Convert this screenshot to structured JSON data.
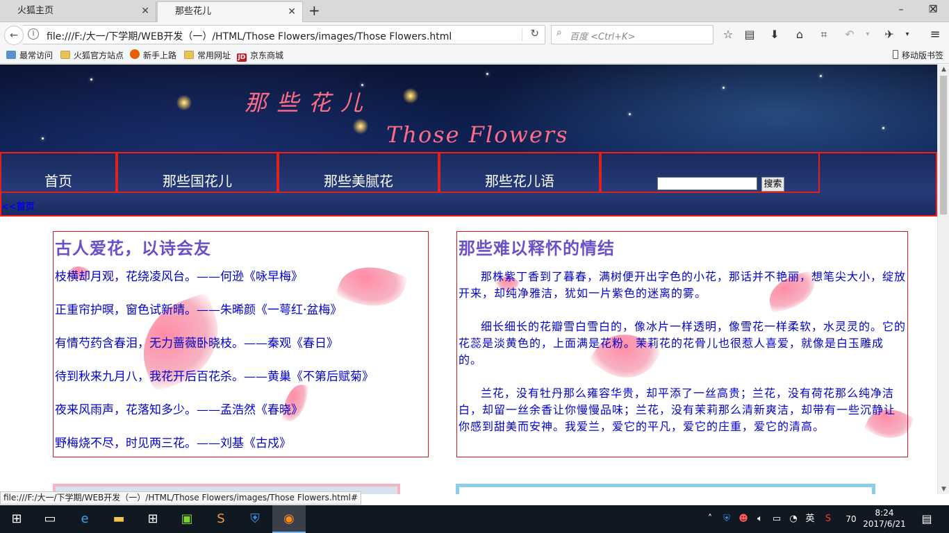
{
  "browser": {
    "tabs": [
      {
        "label": "火狐主页",
        "active": false
      },
      {
        "label": "那些花儿",
        "active": true
      }
    ],
    "new_tab_label": "+",
    "window_controls": {
      "minimize": "–",
      "restore": "❐",
      "close": "✕"
    },
    "url": "file:///F:/大一/下学期/WEB开发（一）/HTML/Those Flowers/images/Those Flowers.html",
    "search_placeholder": "百度 <Ctrl+K>",
    "bookmarks": [
      "最常访问",
      "火狐官方站点",
      "新手上路",
      "常用网址",
      "京东商城"
    ],
    "mobile_bookmarks": "移动版书签",
    "status_url": "file:///F:/大一/下学期/WEB开发（一）/HTML/Those Flowers/images/Those Flowers.html#"
  },
  "page": {
    "title_cn": "那些花儿",
    "title_en": "Those Flowers",
    "nav": [
      "首页",
      "那些国花儿",
      "那些美腻花",
      "那些花儿语"
    ],
    "search_button": "搜索",
    "breadcrumb": "<<首页",
    "left_panel": {
      "heading": "古人爱花，以诗会友",
      "poems": [
        "枝横却月观，花绕凌风台。——何逊《咏早梅》",
        "正重帘护暝，窗色试新晴。——朱晞颜《一萼红·盆梅》",
        "有情芍药含春泪，无力蔷薇卧晓枝。——秦观《春日》",
        "待到秋来九月八，我花开后百花杀。——黄巢《不第后赋菊》",
        "夜来风雨声，花落知多少。——孟浩然《春晓》",
        "野梅烧不尽，时见两三花。——刘基《古戍》"
      ]
    },
    "right_panel": {
      "heading": "那些难以释怀的情结",
      "paragraphs": [
        "那株紫丁香到了暮春，满树便开出字色的小花，那话并不艳丽，想笔尖大小，绽放开来，却纯净雅洁，犹如一片紫色的迷离的雾。",
        "细长细长的花瓣雪白雪白的，像冰片一样透明，像雪花一样柔软，水灵灵的。它的花蕊是淡黄色的，上面满是花粉。茉莉花的花骨儿也很惹人喜爱，就像是白玉雕成的。",
        "兰花，没有牡丹那么雍容华贵，却平添了一丝高贵；兰花，没有荷花那么纯净洁白，却留一丝余香让你慢慢品味；兰花，没有茉莉那么清新爽洁，却带有一些沉静让你感到甜美而安神。我爱兰，爱它的平凡，爱它的庄重，爱它的清高。"
      ]
    },
    "colors": {
      "accent_red": "#e0141c",
      "title_pink": "#ff6c86",
      "heading_purple": "#6b4fc9",
      "text_blue": "#0000cc"
    }
  },
  "taskbar": {
    "tray_lang": "英",
    "tray_badge": "70",
    "time": "8:24",
    "date": "2017/6/21"
  }
}
